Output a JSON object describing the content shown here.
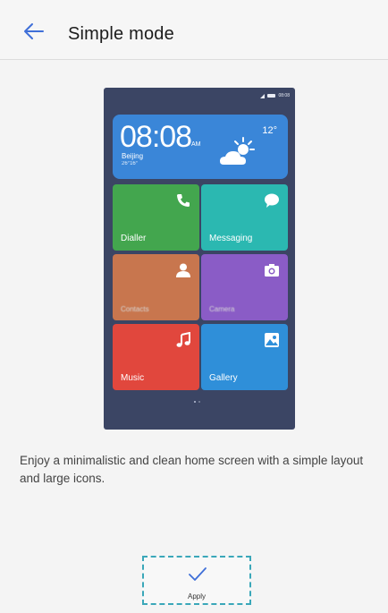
{
  "header": {
    "title": "Simple mode",
    "back_icon": "arrow-left-icon"
  },
  "preview": {
    "status_time": "08:08",
    "weather": {
      "time": "08:08",
      "ampm": "AM",
      "city": "Beijing",
      "range": "26°16°",
      "temperature": "12°",
      "icon": "partly-sunny-icon"
    },
    "tiles": [
      {
        "label": "Dialler",
        "icon": "phone-icon"
      },
      {
        "label": "Messaging",
        "icon": "chat-bubble-icon"
      },
      {
        "label": "Contacts",
        "icon": "person-icon"
      },
      {
        "label": "Camera",
        "icon": "camera-icon"
      },
      {
        "label": "Music",
        "icon": "music-note-icon"
      },
      {
        "label": "Gallery",
        "icon": "image-icon"
      }
    ],
    "colors": {
      "dialler": "#43a64e",
      "messaging": "#2bb8b1",
      "contacts": "#c8764e",
      "camera": "#8a5cc6",
      "music": "#e1473d",
      "gallery": "#2f8fd9",
      "weather": "#3a86d8",
      "background": "#3b4564"
    }
  },
  "description": "Enjoy a minimalistic and clean home screen with a simple layout and large icons.",
  "apply": {
    "label": "Apply",
    "icon": "check-icon"
  },
  "accent_color": "#3f6fd8"
}
